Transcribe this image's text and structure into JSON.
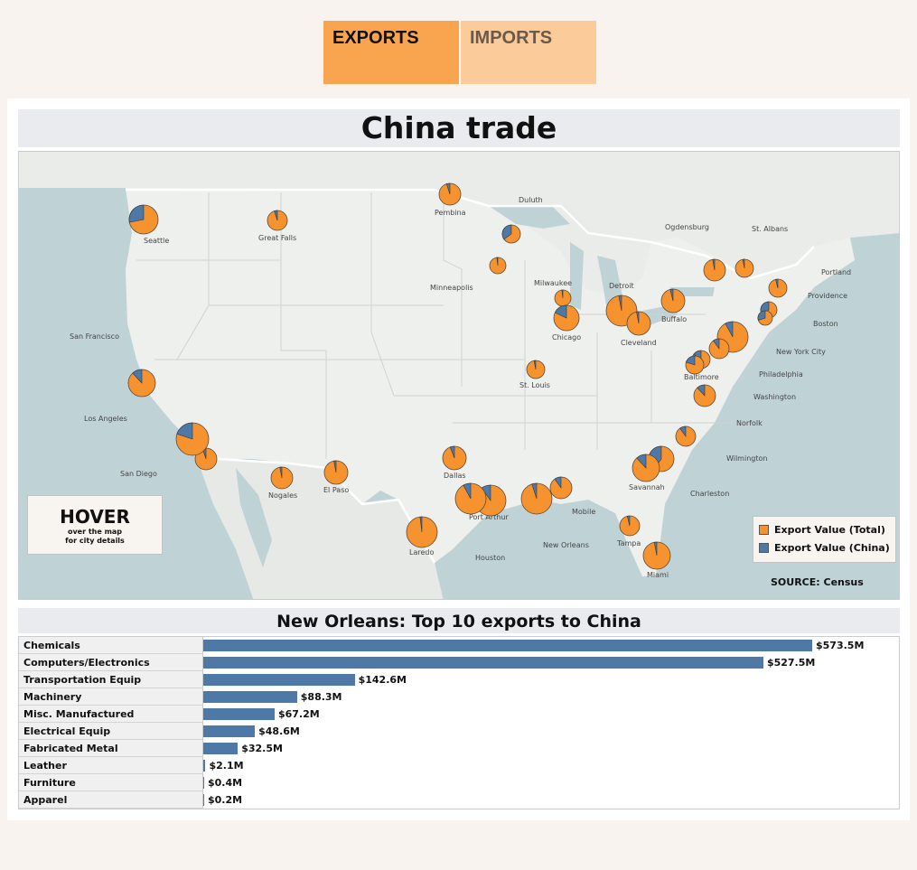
{
  "tabs": {
    "exports": "EXPORTS",
    "imports": "IMPORTS"
  },
  "title": "China trade",
  "hover": {
    "title": "HOVER",
    "line1": "over the map",
    "line2": "for city details"
  },
  "legend": {
    "total_label": "Export Value (Total)",
    "china_label": "Export Value (China)",
    "total_color": "#f7932f",
    "china_color": "#4e79a7"
  },
  "source": "SOURCE: Census",
  "city_labels": {
    "seattle": "Seattle",
    "great_falls": "Great Falls",
    "pembina": "Pembina",
    "duluth": "Duluth",
    "ogdensburg": "Ogdensburg",
    "st_albans": "St. Albans",
    "portland": "Portland",
    "providence": "Providence",
    "boston": "Boston",
    "new_york": "New York City",
    "philadelphia": "Philadelphia",
    "baltimore": "Baltimore",
    "washington": "Washington",
    "norfolk": "Norfolk",
    "wilmington": "Wilmington",
    "charleston": "Charleston",
    "savannah": "Savannah",
    "tampa": "Tampa",
    "miami": "Miami",
    "mobile": "Mobile",
    "new_orleans": "New Orleans",
    "port_arthur": "Port Arthur",
    "houston": "Houston",
    "laredo": "Laredo",
    "dallas": "Dallas",
    "el_paso": "El Paso",
    "nogales": "Nogales",
    "san_diego": "San Diego",
    "los_angeles": "Los Angeles",
    "san_francisco": "San Francisco",
    "minneapolis": "Minneapolis",
    "milwaukee": "Milwaukee",
    "chicago": "Chicago",
    "detroit": "Detroit",
    "cleveland": "Cleveland",
    "buffalo": "Buffalo",
    "st_louis": "St. Louis"
  },
  "bar_chart": {
    "title": "New Orleans: Top 10 exports to China",
    "bar_color": "#4e79a7",
    "rows": [
      {
        "label": "Chemicals",
        "value": 573.5,
        "display": "$573.5M"
      },
      {
        "label": "Computers/Electronics",
        "value": 527.5,
        "display": "$527.5M"
      },
      {
        "label": "Transportation Equip",
        "value": 142.6,
        "display": "$142.6M"
      },
      {
        "label": "Machinery",
        "value": 88.3,
        "display": "$88.3M"
      },
      {
        "label": "Misc. Manufactured",
        "value": 67.2,
        "display": "$67.2M"
      },
      {
        "label": "Electrical Equip",
        "value": 48.6,
        "display": "$48.6M"
      },
      {
        "label": "Fabricated Metal",
        "value": 32.5,
        "display": "$32.5M"
      },
      {
        "label": "Leather",
        "value": 2.1,
        "display": "$2.1M"
      },
      {
        "label": "Furniture",
        "value": 0.4,
        "display": "$0.4M"
      },
      {
        "label": "Apparel",
        "value": 0.2,
        "display": "$0.2M"
      }
    ]
  }
}
